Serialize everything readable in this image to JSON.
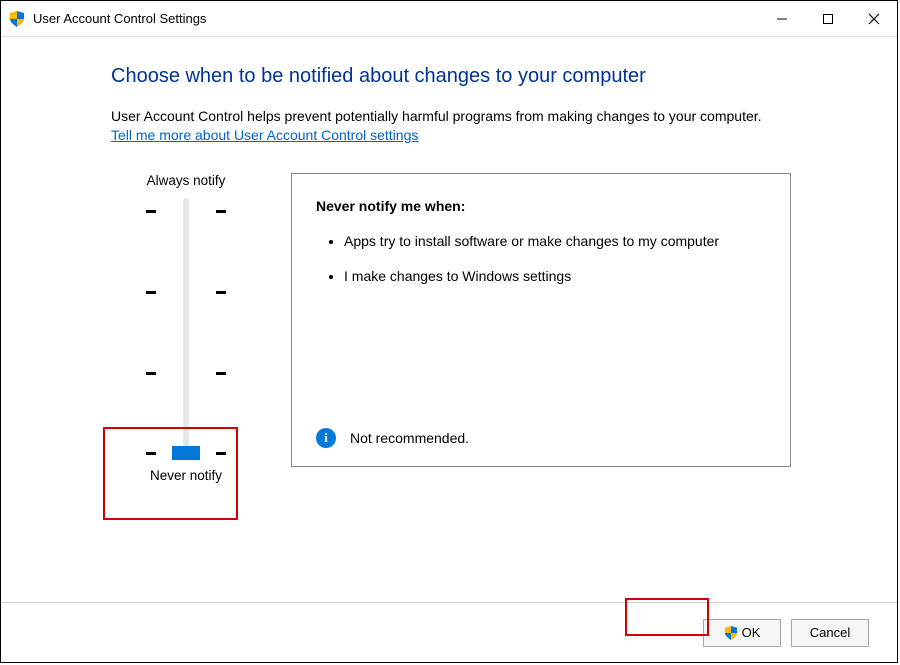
{
  "window": {
    "title": "User Account Control Settings"
  },
  "heading": "Choose when to be notified about changes to your computer",
  "subtext": "User Account Control helps prevent potentially harmful programs from making changes to your computer.",
  "link": "Tell me more about User Account Control settings",
  "slider": {
    "top_label": "Always notify",
    "bottom_label": "Never notify"
  },
  "panel": {
    "title": "Never notify me when:",
    "bullets": [
      "Apps try to install software or make changes to my computer",
      "I make changes to Windows settings"
    ],
    "footer": "Not recommended."
  },
  "buttons": {
    "ok": "OK",
    "cancel": "Cancel"
  }
}
